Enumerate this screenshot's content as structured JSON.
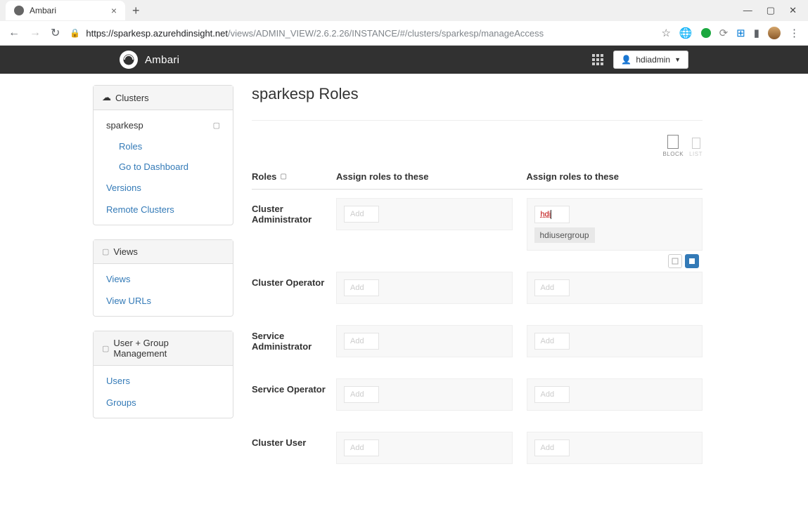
{
  "browser": {
    "tab_title": "Ambari",
    "url_host": "https://sparkesp.azurehdinsight.net",
    "url_path": "/views/ADMIN_VIEW/2.6.2.26/INSTANCE/#/clusters/sparkesp/manageAccess"
  },
  "header": {
    "brand": "Ambari",
    "user": "hdiadmin"
  },
  "sidebar": {
    "clusters_label": "Clusters",
    "cluster_name": "sparkesp",
    "roles": "Roles",
    "goto_dashboard": "Go to Dashboard",
    "versions": "Versions",
    "remote_clusters": "Remote Clusters",
    "views_label": "Views",
    "views": "Views",
    "view_urls": "View URLs",
    "ugm_label": "User + Group Management",
    "users": "Users",
    "groups": "Groups"
  },
  "main": {
    "title": "sparkesp Roles",
    "view_block": "BLOCK",
    "view_list": "LIST",
    "col_roles": "Roles",
    "col_assign1": "Assign roles to these",
    "col_assign2": "Assign roles to these",
    "add_placeholder": "Add",
    "input_value": "hdi",
    "suggestion": "hdiusergroup",
    "roles": {
      "r1": "Cluster Administrator",
      "r2": "Cluster Operator",
      "r3": "Service Administrator",
      "r4": "Service Operator",
      "r5": "Cluster User"
    }
  }
}
